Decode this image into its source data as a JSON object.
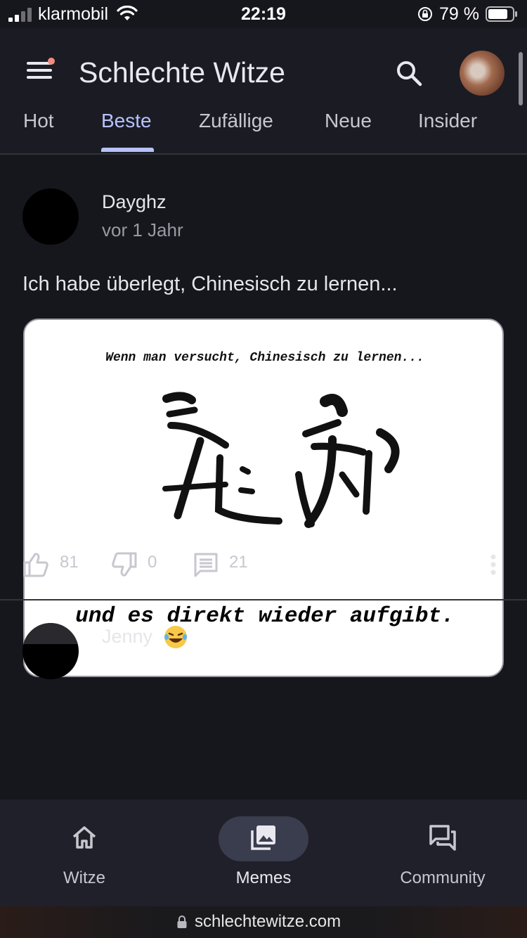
{
  "status_bar": {
    "carrier": "klarmobil",
    "time": "22:19",
    "battery": "79 %"
  },
  "app_bar": {
    "title": "Schlechte Witze"
  },
  "tabs": [
    {
      "label": "Hot",
      "active": false
    },
    {
      "label": "Beste",
      "active": true
    },
    {
      "label": "Zufällige",
      "active": false
    },
    {
      "label": "Neue",
      "active": false
    },
    {
      "label": "Insider",
      "active": false
    }
  ],
  "post": {
    "author": "Dayghz",
    "time": "vor 1 Jahr",
    "text": "Ich habe überlegt, Chinesisch zu lernen...",
    "meme": {
      "top_text": "Wenn man versucht, Chinesisch zu lernen...",
      "bottom_text": "und es direkt wieder aufgibt."
    },
    "likes": "81",
    "dislikes": "0",
    "comments": "21"
  },
  "next_post": {
    "author": "Jenny"
  },
  "bottom_nav": [
    {
      "label": "Witze",
      "icon": "home-icon",
      "active": false
    },
    {
      "label": "Memes",
      "icon": "images-icon",
      "active": true
    },
    {
      "label": "Community",
      "icon": "forum-icon",
      "active": false
    }
  ],
  "url_bar": {
    "url": "schlechtewitze.com"
  },
  "colors": {
    "background": "#16161d",
    "app_bar": "#1b1b23",
    "accent": "#b7c2ff",
    "nav_pill": "#3a3d4e",
    "notification_dot": "#f28b82"
  }
}
